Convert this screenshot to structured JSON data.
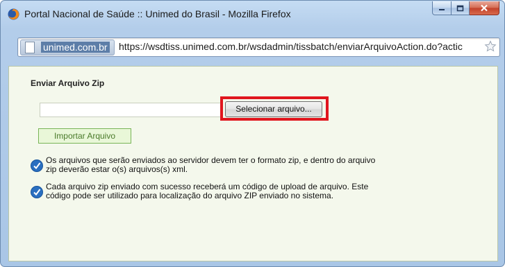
{
  "window": {
    "title": "Portal Nacional de Saúde :: Unimed do Brasil - Mozilla Firefox"
  },
  "address_bar": {
    "site_identity": "unimed.com.br",
    "url": "https://wsdtiss.unimed.com.br/wsdadmin/tissbatch/enviarArquivoAction.do?actic"
  },
  "form": {
    "title": "Enviar Arquivo Zip",
    "file_input_value": "",
    "select_button_label": "Selecionar arquivo...",
    "import_button_label": "Importar Arquivo"
  },
  "info": [
    {
      "line1": "Os arquivos que serão enviados ao servidor devem ter o formato zip, e dentro do arquivo",
      "line2": "zip deverão estar o(s) arquivos(s) xml."
    },
    {
      "line1": "Cada arquivo zip enviado com sucesso receberá um código de upload de arquivo. Este",
      "line2": "código pode ser utilizado para localização do arquivo ZIP enviado no sistema."
    }
  ],
  "colors": {
    "highlight": "#e0161e",
    "content_bg": "#f4f8ec",
    "import_button_text": "#4a7a2a"
  }
}
